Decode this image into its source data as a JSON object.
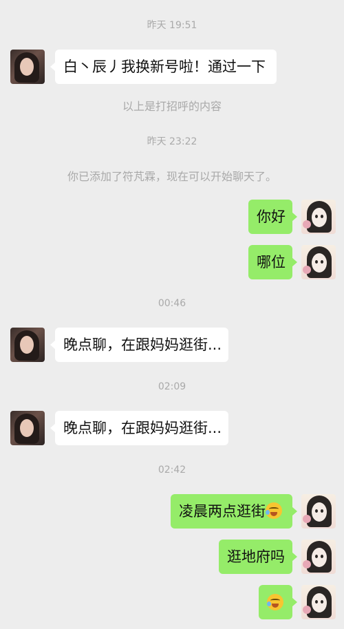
{
  "messages": {
    "ts1": "昨天 19:51",
    "m1": "白丶辰丿我换新号啦！通过一下",
    "sys1": "以上是打招呼的内容",
    "ts2": "昨天 23:22",
    "sys2": "你已添加了符芃霖，现在可以开始聊天了。",
    "m2": "你好",
    "m3": "哪位",
    "ts3": "00:46",
    "m4": "晚点聊，在跟妈妈逛街...",
    "ts4": "02:09",
    "m5": "晚点聊，在跟妈妈逛街...",
    "ts5": "02:42",
    "m6": "凌晨两点逛街",
    "m7": "逛地府吗"
  },
  "icons": {
    "contact_avatar": "woman-photo-avatar",
    "self_avatar": "anime-girl-avatar",
    "emoji": "crying-laughing-emoji"
  },
  "colors": {
    "background": "#ededed",
    "sent_bubble": "#95ec69",
    "received_bubble": "#ffffff",
    "timestamp": "#a9a9a9"
  }
}
